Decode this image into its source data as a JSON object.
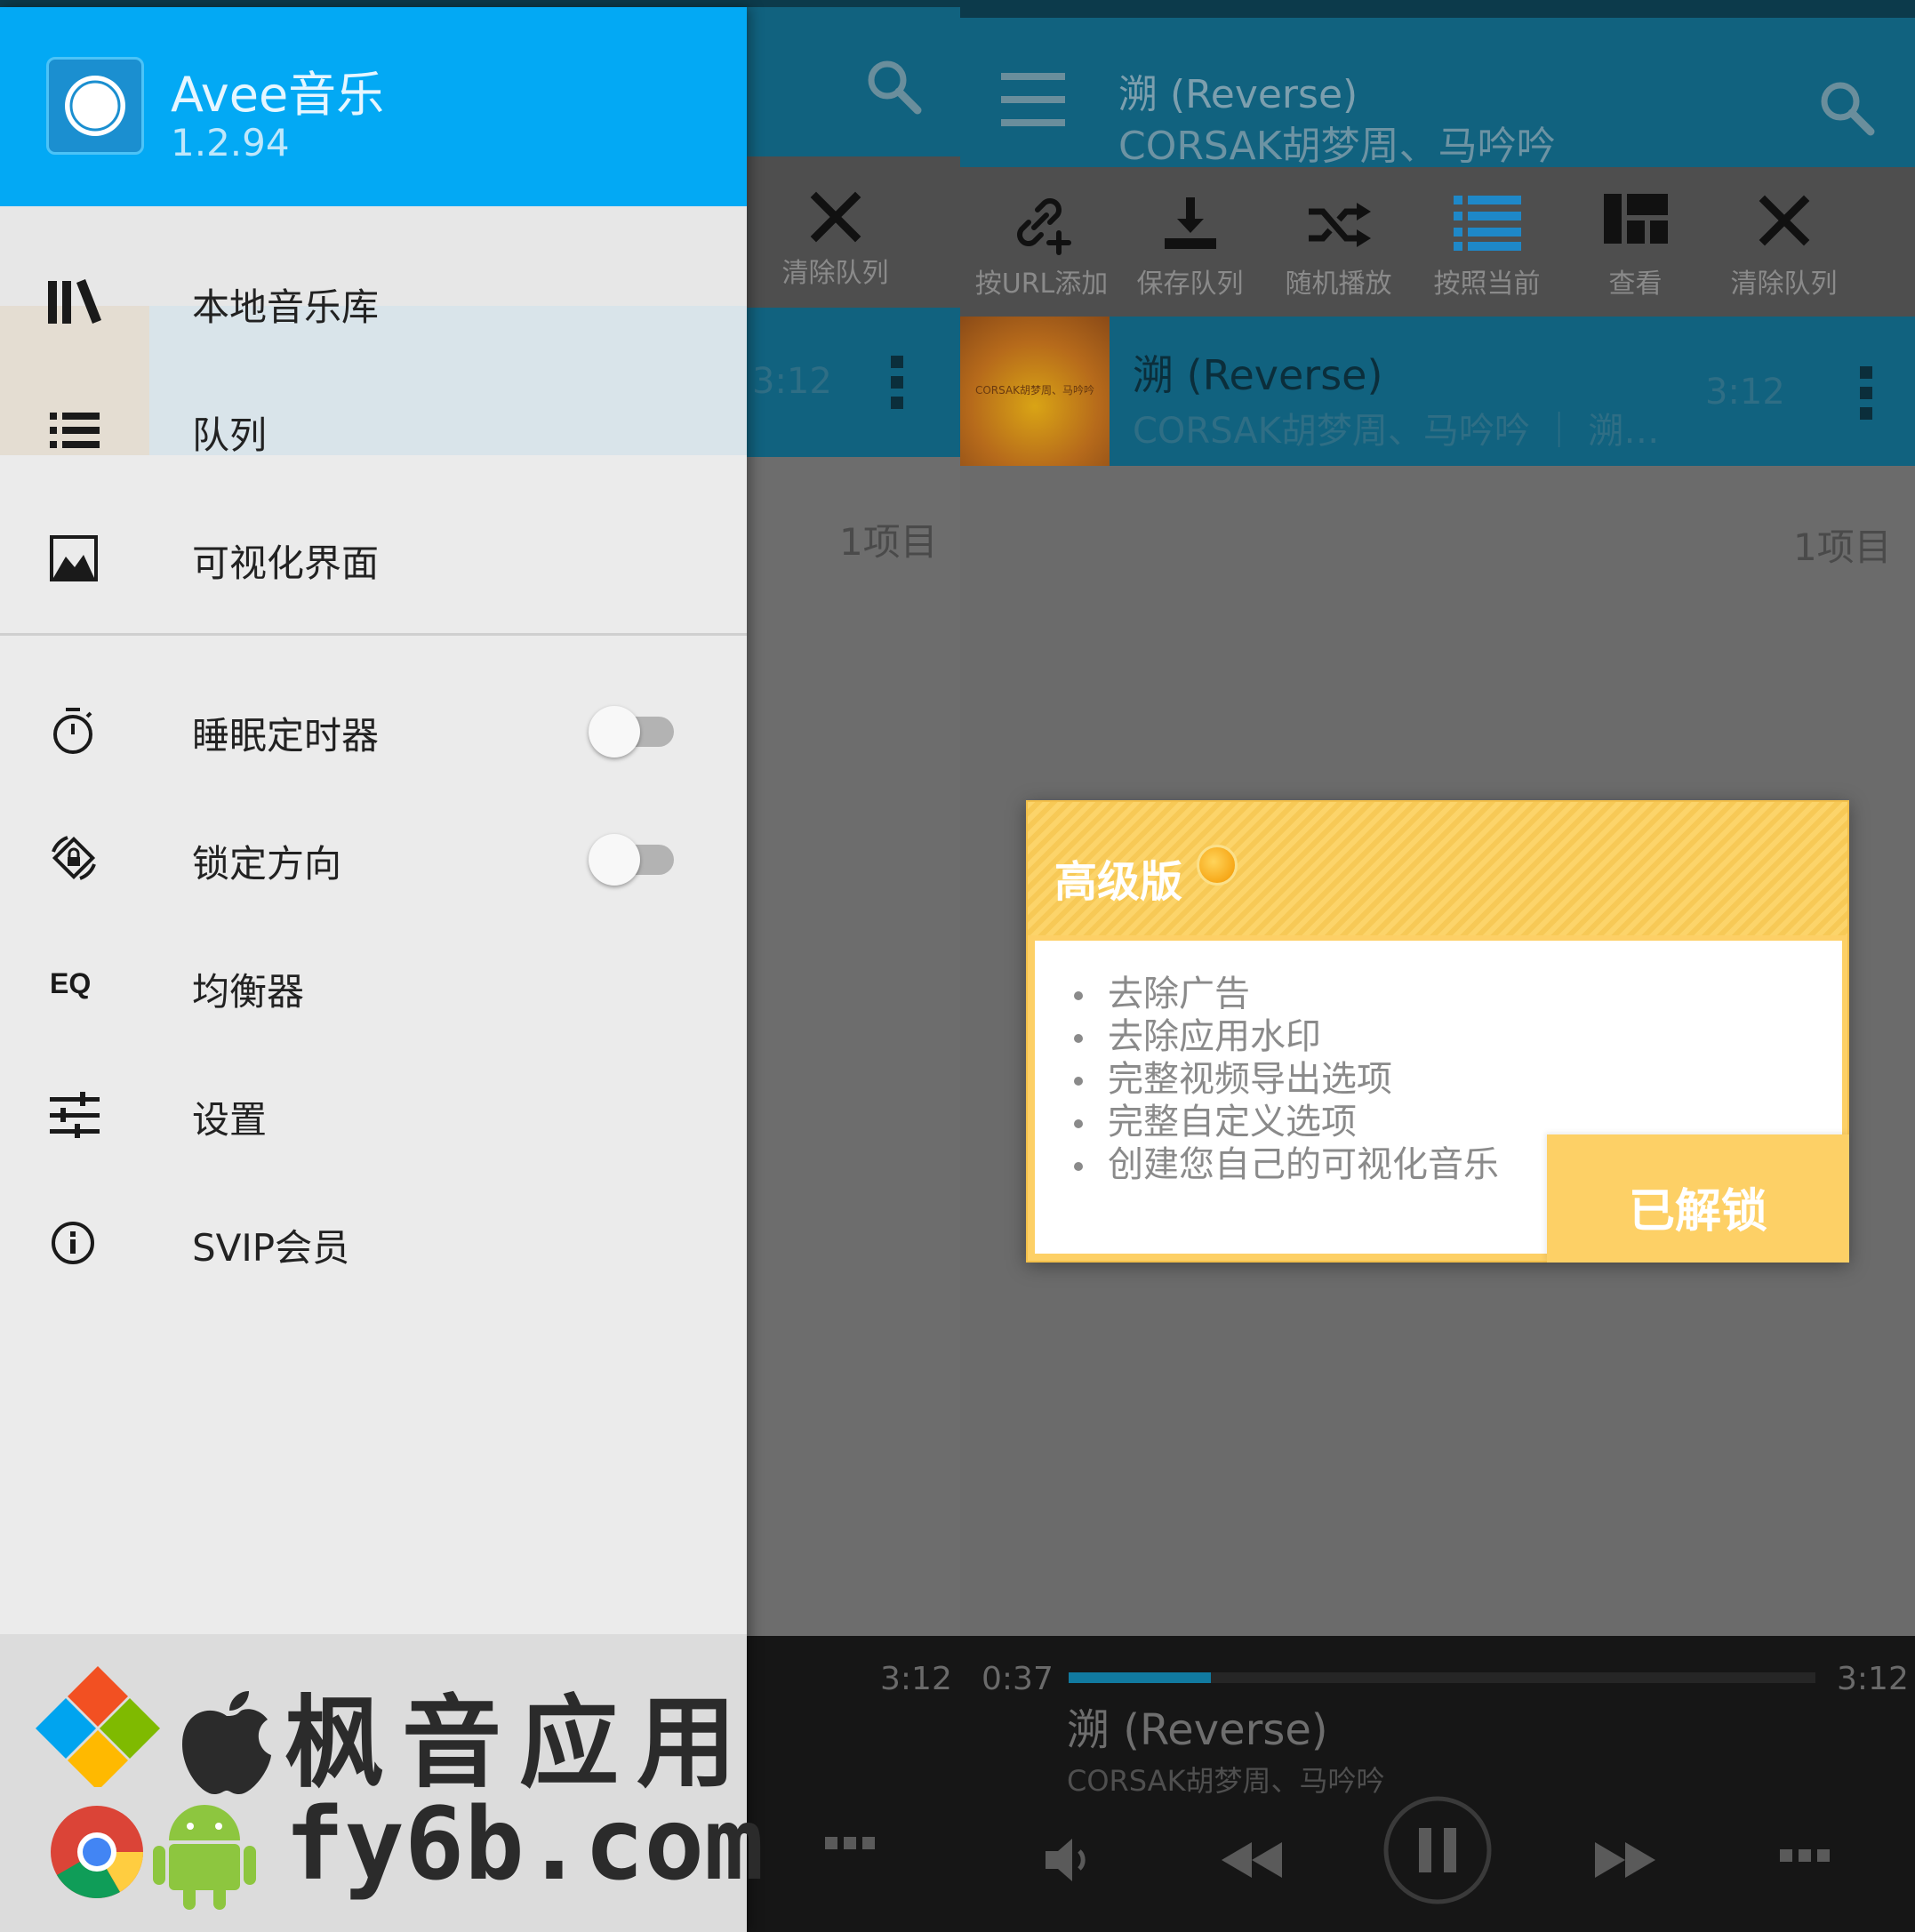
{
  "drawer": {
    "app_name": "Avee音乐",
    "version": "1.2.94",
    "items": [
      {
        "label": "本地音乐库",
        "icon": "library-icon"
      },
      {
        "label": "队列",
        "icon": "queue-list-icon"
      },
      {
        "label": "可视化界面",
        "icon": "image-icon"
      },
      {
        "label": "睡眠定时器",
        "icon": "timer-icon",
        "toggle": false
      },
      {
        "label": "锁定方向",
        "icon": "rotation-lock-icon",
        "toggle": false
      },
      {
        "label": "均衡器",
        "icon": "eq-icon",
        "icon_text": "EQ"
      },
      {
        "label": "设置",
        "icon": "sliders-icon"
      },
      {
        "label": "SVIP会员",
        "icon": "info-icon"
      }
    ]
  },
  "queue_screen": {
    "now_playing_title": "溯 (Reverse)",
    "now_playing_artist": "CORSAK胡梦周、马吟吟",
    "toolbar": [
      {
        "label": "按URL添加",
        "icon": "link-add-icon"
      },
      {
        "label": "保存队列",
        "icon": "download-icon"
      },
      {
        "label": "随机播放",
        "icon": "shuffle-icon"
      },
      {
        "label": "按照当前",
        "icon": "list-icon"
      },
      {
        "label": "查看",
        "icon": "grid-view-icon"
      },
      {
        "label": "清除队列",
        "icon": "close-icon"
      }
    ],
    "track": {
      "title": "溯 (Reverse)",
      "subtitle": "CORSAK胡梦周、马吟吟 ｜ 溯…",
      "art_text": "CORSAK胡梦周、马吟吟",
      "duration": "3:12"
    },
    "item_count": "1项目",
    "player": {
      "position": "0:37",
      "duration": "3:12",
      "progress": 0.19,
      "title": "溯 (Reverse)",
      "artist": "CORSAK胡梦周、马吟吟"
    }
  },
  "dialog": {
    "title": "高级版",
    "features": [
      "去除广告",
      "去除应用水印",
      "完整视频导出选项",
      "完整自定义选项",
      "创建您自己的可视化音乐"
    ],
    "button": "已解锁"
  },
  "watermark": {
    "line1": "枫音应用",
    "line2": "fy6b.com"
  },
  "colors": {
    "drawer_header": "#03a9f4",
    "appbar": "#11627f",
    "dialog": "#fdd066",
    "drawer_bg": "#ebebeb"
  }
}
